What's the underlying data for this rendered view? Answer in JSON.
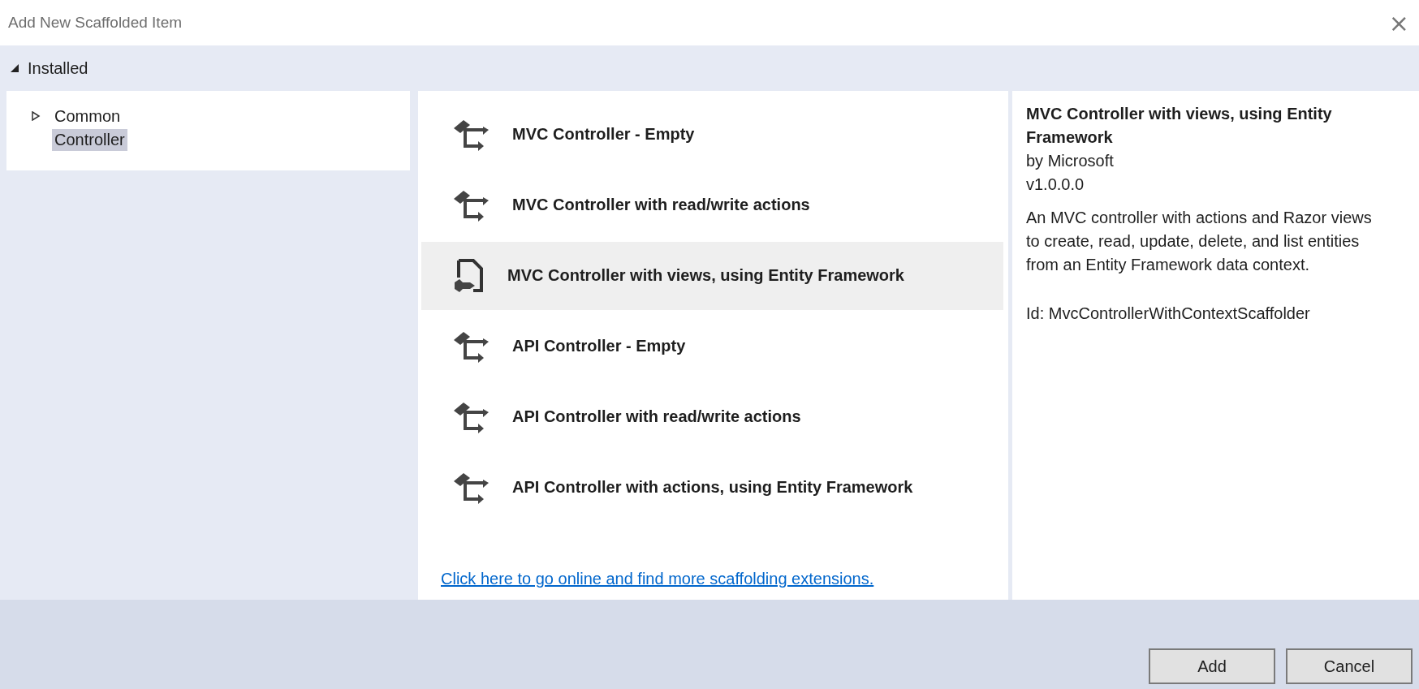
{
  "window": {
    "title": "Add New Scaffolded Item",
    "close": "×"
  },
  "installed": {
    "label": "Installed",
    "expanded": true
  },
  "tree": [
    {
      "label": "Common",
      "expanded": false,
      "selected": false
    },
    {
      "label": "Controller",
      "selected": true
    }
  ],
  "templates": [
    {
      "label": "MVC Controller - Empty",
      "kind": "controller",
      "selected": false
    },
    {
      "label": "MVC Controller with read/write actions",
      "kind": "controller",
      "selected": false
    },
    {
      "label": "MVC Controller with views, using Entity Framework",
      "kind": "views",
      "selected": true
    },
    {
      "label": "API Controller - Empty",
      "kind": "controller",
      "selected": false
    },
    {
      "label": "API Controller with read/write actions",
      "kind": "controller",
      "selected": false
    },
    {
      "label": "API Controller with actions, using Entity Framework",
      "kind": "controller",
      "selected": false
    }
  ],
  "online_link": "Click here to go online and find more scaffolding extensions.",
  "details": {
    "title": "MVC Controller with views, using Entity Framework",
    "author": "by Microsoft",
    "version": "v1.0.0.0",
    "description": "An MVC controller with actions and Razor views to create, read, update, delete, and list entities from an Entity Framework data context.",
    "id": "Id: MvcControllerWithContextScaffolder"
  },
  "buttons": [
    "Add",
    "Cancel"
  ]
}
